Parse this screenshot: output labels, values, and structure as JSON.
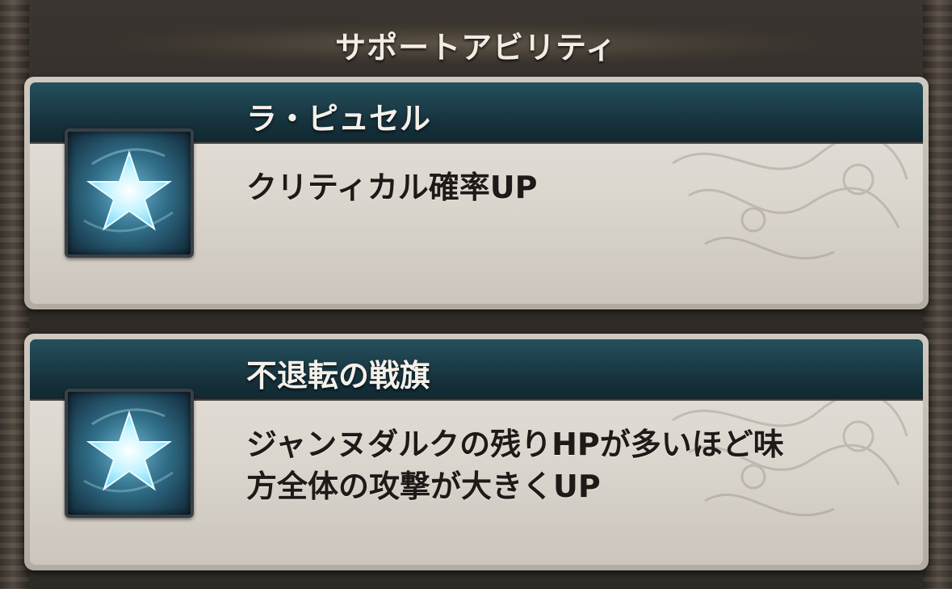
{
  "header": {
    "title": "サポートアビリティ"
  },
  "abilities": [
    {
      "icon": "star-icon",
      "name": "ラ・ピュセル",
      "description": [
        "クリティカル確率UP"
      ]
    },
    {
      "icon": "star-icon",
      "name": "不退転の戦旗",
      "description": [
        "ジャンヌダルクの残りHPが多いほど味",
        "方全体の攻撃が大きくUP"
      ]
    }
  ],
  "colors": {
    "header_band": "#15303a",
    "card_bg": "#dad5cd",
    "icon_glow": "#bff3ff"
  }
}
